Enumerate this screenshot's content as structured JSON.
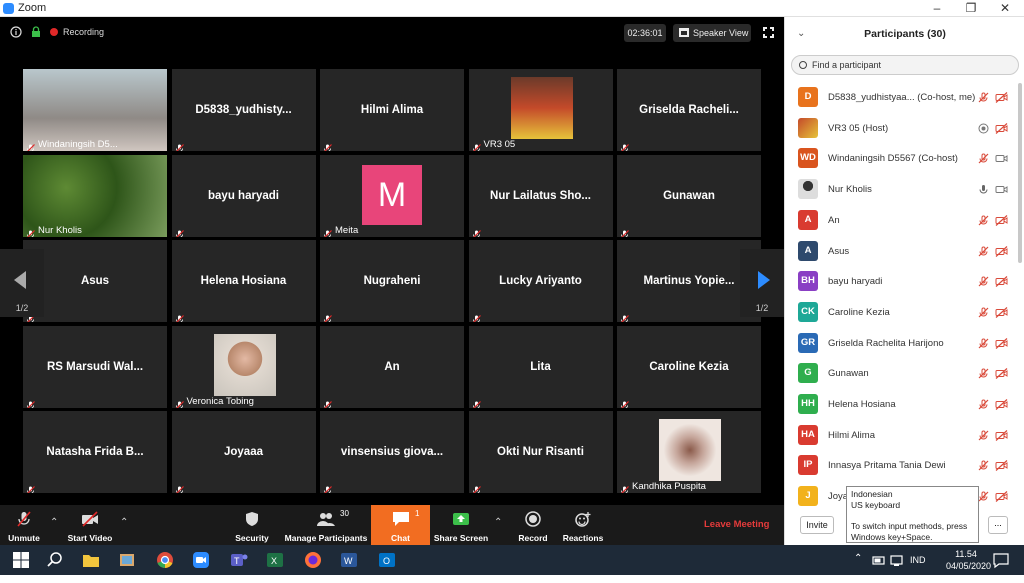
{
  "window": {
    "title": "Zoom"
  },
  "topbar": {
    "recording": "Recording",
    "timer": "02:36:01",
    "speaker_view": "Speaker View"
  },
  "colors": {
    "accent": "#2d8cff",
    "leave": "#e53b3b",
    "chat": "#f26d21",
    "active_border": "#d8c32a"
  },
  "tiles": [
    {
      "name": "Windaningsih D5...",
      "kind": "label",
      "photo": "room"
    },
    {
      "name": "D5838_yudhisty...",
      "kind": "center"
    },
    {
      "name": "Hilmi Alima",
      "kind": "center"
    },
    {
      "name": "VR3 05",
      "kind": "label",
      "photo": "stage"
    },
    {
      "name": "Griselda  Racheli...",
      "kind": "center"
    },
    {
      "name": "Nur Kholis",
      "kind": "label",
      "photo": "garden",
      "active": true
    },
    {
      "name": "bayu haryadi",
      "kind": "center"
    },
    {
      "name": "Meita",
      "kind": "label",
      "avatar": "M"
    },
    {
      "name": "Nur  Lailatus  Sho...",
      "kind": "center"
    },
    {
      "name": "Gunawan",
      "kind": "center"
    },
    {
      "name": "Asus",
      "kind": "center"
    },
    {
      "name": "Helena Hosiana",
      "kind": "center"
    },
    {
      "name": "Nugraheni",
      "kind": "center"
    },
    {
      "name": "Lucky Ariyanto",
      "kind": "center"
    },
    {
      "name": "Martinus  Yopie...",
      "kind": "center"
    },
    {
      "name": "RS  Marsudi  Wal...",
      "kind": "center"
    },
    {
      "name": "Veronica Tobing",
      "kind": "label",
      "photo": "portrait"
    },
    {
      "name": "An",
      "kind": "center"
    },
    {
      "name": "Lita",
      "kind": "center"
    },
    {
      "name": "Caroline Kezia",
      "kind": "center"
    },
    {
      "name": "Natasha  Frida  B...",
      "kind": "center"
    },
    {
      "name": "Joyaaa",
      "kind": "center"
    },
    {
      "name": "vinsensius  giova...",
      "kind": "center"
    },
    {
      "name": "Okti Nur Risanti",
      "kind": "center"
    },
    {
      "name": "Kandhika Puspita",
      "kind": "label",
      "photo": "flower"
    }
  ],
  "paging": {
    "left": "1/2",
    "right": "1/2"
  },
  "toolbar": {
    "unmute": "Unmute",
    "start_video": "Start Video",
    "security": "Security",
    "manage_participants": "Manage Participants",
    "participant_count": "30",
    "chat": "Chat",
    "chat_badge": "1",
    "share_screen": "Share Screen",
    "record": "Record",
    "reactions": "Reactions",
    "leave": "Leave Meeting"
  },
  "panel": {
    "title": "Participants (30)",
    "search_placeholder": "Find a participant",
    "invite": "Invite",
    "more": "...",
    "participants": [
      {
        "initials": "D",
        "color": "#e8731d",
        "name": "D5838_yudhistyaa... (Co-host, me)",
        "mic": "muted-red",
        "video": "off-red"
      },
      {
        "initials": "",
        "color": "#7a5a8c",
        "name": "VR3 05 (Host)",
        "mic": "record-grey",
        "video": "off-red",
        "photo": true
      },
      {
        "initials": "WD",
        "color": "#d9541e",
        "name": "Windaningsih D5567 (Co-host)",
        "mic": "muted-red",
        "video": "on-grey"
      },
      {
        "initials": "",
        "color": "#444444",
        "name": "Nur Kholis",
        "mic": "on-grey",
        "video": "on-grey",
        "photo": true
      },
      {
        "initials": "A",
        "color": "#d93b30",
        "name": "An",
        "mic": "muted-red",
        "video": "off-red"
      },
      {
        "initials": "A",
        "color": "#2e4a6d",
        "name": "Asus",
        "mic": "muted-red",
        "video": "off-red"
      },
      {
        "initials": "BH",
        "color": "#8a3fc4",
        "name": "bayu haryadi",
        "mic": "muted-red",
        "video": "off-red"
      },
      {
        "initials": "CK",
        "color": "#1ea897",
        "name": "Caroline Kezia",
        "mic": "muted-red",
        "video": "off-red"
      },
      {
        "initials": "GR",
        "color": "#2a6ab5",
        "name": "Griselda Rachelita Harijono",
        "mic": "muted-red",
        "video": "off-red"
      },
      {
        "initials": "G",
        "color": "#2fae4e",
        "name": "Gunawan",
        "mic": "muted-red",
        "video": "off-red"
      },
      {
        "initials": "HH",
        "color": "#2fae4e",
        "name": "Helena Hosiana",
        "mic": "muted-red",
        "video": "off-red"
      },
      {
        "initials": "HA",
        "color": "#d93b30",
        "name": "Hilmi Alima",
        "mic": "muted-red",
        "video": "off-red"
      },
      {
        "initials": "IP",
        "color": "#d93b30",
        "name": "Innasya Pritama Tania Dewi",
        "mic": "muted-red",
        "video": "off-red"
      },
      {
        "initials": "J",
        "color": "#f2b21c",
        "name": "Joya",
        "mic": "muted-red",
        "video": "off-red"
      }
    ]
  },
  "tooltip": {
    "line1": "Indonesian",
    "line2": "US keyboard",
    "line3": "To switch input methods, press",
    "line4": "Windows key+Space."
  },
  "taskbar": {
    "lang": "IND",
    "time": "11.54",
    "date": "04/05/2020"
  }
}
